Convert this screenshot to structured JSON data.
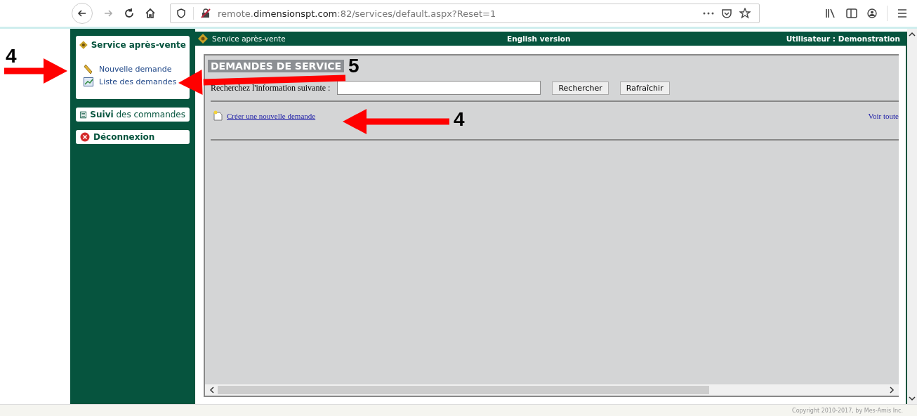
{
  "browser": {
    "url": "remote.**dimensionspt.com**:82/services/default.aspx?Reset=1"
  },
  "sidebar": {
    "sections": [
      {
        "title": "Service après-vente",
        "items": [
          {
            "label": "Nouvelle demande"
          },
          {
            "label": "Liste des demandes"
          }
        ]
      },
      {
        "title": "**Suivi** des commandes"
      },
      {
        "title": "Déconnexion"
      }
    ]
  },
  "header": {
    "title": "Service après-vente",
    "center": "English version",
    "user": "Utilisateur : Demonstration"
  },
  "panel": {
    "title": "DEMANDES DE SERVICE",
    "search_label": "Recherchez l'information suivante :",
    "buttons": [
      "Rechercher",
      "Rafraîchir"
    ],
    "create_link": "Créer une nouvelle demande",
    "view_all": "Voir toute"
  },
  "footer": {
    "copyright": "Copyright 2010-2017, by Mes-Amis Inc."
  },
  "annotations": [
    {
      "label": "4"
    },
    {
      "label": "5"
    },
    {
      "label": "4"
    }
  ]
}
